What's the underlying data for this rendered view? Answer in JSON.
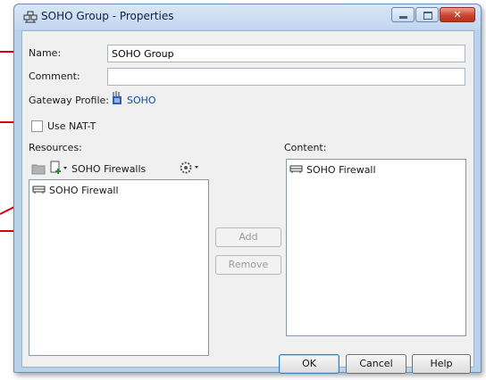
{
  "window": {
    "title": "SOHO Group - Properties",
    "icon": "group-icon"
  },
  "form": {
    "name_label": "Name:",
    "name_value": "SOHO Group",
    "comment_label": "Comment:",
    "comment_value": "",
    "gateway_label": "Gateway Profile:",
    "gateway_value": "SOHO",
    "nat_label": "Use NAT-T",
    "nat_checked": false
  },
  "resources": {
    "label": "Resources:",
    "filter_value": "SOHO Firewalls",
    "items": [
      {
        "label": "SOHO Firewall",
        "icon": "firewall-icon"
      }
    ]
  },
  "content": {
    "label": "Content:",
    "items": [
      {
        "label": "SOHO Firewall",
        "icon": "firewall-icon"
      }
    ]
  },
  "actions": {
    "add": "Add",
    "remove": "Remove"
  },
  "footer": {
    "ok": "OK",
    "cancel": "Cancel",
    "help": "Help"
  },
  "colors": {
    "marker": "#d7000b",
    "link": "#0b4fb8"
  }
}
